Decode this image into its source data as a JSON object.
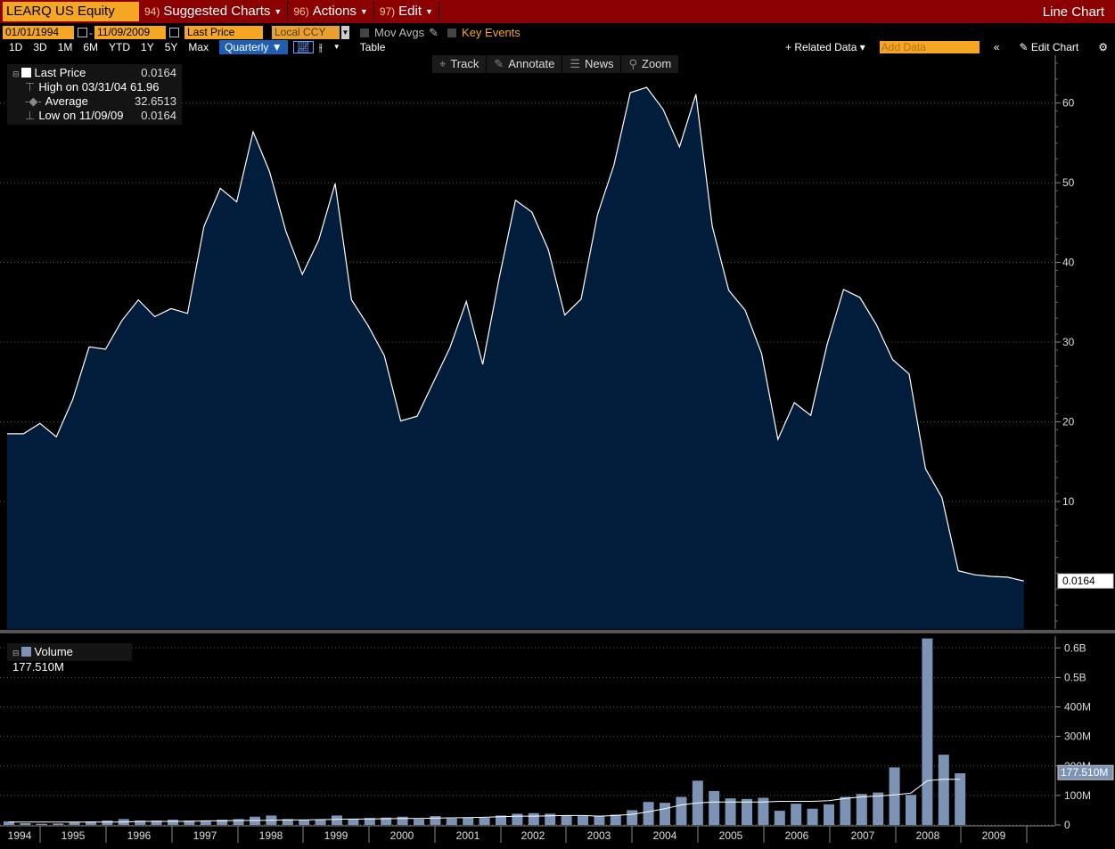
{
  "toolbar": {
    "ticker": "LEARQ US Equity",
    "suggested_num": "94)",
    "suggested_label": "Suggested Charts",
    "actions_num": "96)",
    "actions_label": "Actions",
    "edit_num": "97)",
    "edit_label": "Edit",
    "chart_type": "Line Chart"
  },
  "controls": {
    "start_date": "01/01/1994",
    "end_date": "11/09/2009",
    "field": "Last Price",
    "currency": "Local CCY",
    "mov_avgs": "Mov Avgs",
    "key_events": "Key Events",
    "periods": [
      "1D",
      "3D",
      "1M",
      "6M",
      "YTD",
      "1Y",
      "5Y",
      "Max"
    ],
    "frequency": "Quarterly",
    "table": "Table",
    "related_data": "+ Related Data",
    "add_data_placeholder": "Add Data",
    "edit_chart": "Edit Chart"
  },
  "tools": [
    "Track",
    "Annotate",
    "News",
    "Zoom"
  ],
  "legend": {
    "last_price_label": "Last Price",
    "last_price_value": "0.0164",
    "high_label": "High on 03/31/04",
    "high_value": "61.96",
    "average_label": "Average",
    "average_value": "32.6513",
    "low_label": "Low on 11/09/09",
    "low_value": "0.0164",
    "volume_label": "Volume",
    "volume_value": "177.510M"
  },
  "chart_data": [
    {
      "type": "area",
      "series": [
        {
          "name": "Last Price",
          "values": [
            18.5,
            18.5,
            19.8,
            18.1,
            22.8,
            29.4,
            29.1,
            32.7,
            35.3,
            33.2,
            34.2,
            33.6,
            44.5,
            49.3,
            47.6,
            56.4,
            51.4,
            43.9,
            38.5,
            42.8,
            49.9,
            35.3,
            32.1,
            28.3,
            20.1,
            20.7,
            25.0,
            29.3,
            35.1,
            27.2,
            38.0,
            47.8,
            46.3,
            41.6,
            33.4,
            35.4,
            46.0,
            52.2,
            61.3,
            61.96,
            59.2,
            54.5,
            61.1,
            44.5,
            36.5,
            34.0,
            28.6,
            17.8,
            22.4,
            20.8,
            29.7,
            36.6,
            35.6,
            32.2,
            27.8,
            26.0,
            14.1,
            10.5,
            1.3,
            0.8,
            0.6,
            0.5,
            0.0164
          ]
        }
      ],
      "x_start": "1994-Q1",
      "x_ticks": [
        "1994",
        "1995",
        "1996",
        "1997",
        "1998",
        "1999",
        "2000",
        "2001",
        "2002",
        "2003",
        "2004",
        "2005",
        "2006",
        "2007",
        "2008",
        "2009"
      ],
      "y_ticks": [
        10,
        20,
        30,
        40,
        50,
        60
      ],
      "ylim": [
        -6,
        66
      ],
      "last_label": "0.0164",
      "grid": true
    },
    {
      "type": "bar",
      "series": [
        {
          "name": "Volume",
          "values": [
            12,
            6,
            4,
            5,
            10,
            12,
            15,
            20,
            15,
            15,
            18,
            15,
            14,
            18,
            20,
            28,
            32,
            20,
            18,
            18,
            32,
            20,
            24,
            25,
            28,
            20,
            30,
            22,
            24,
            24,
            32,
            38,
            40,
            38,
            32,
            30,
            30,
            35,
            50,
            78,
            75,
            95,
            150,
            115,
            90,
            88,
            92,
            48,
            72,
            55,
            70,
            95,
            105,
            110,
            195,
            102,
            632,
            238,
            175
          ]
        },
        {
          "name": "",
          "values": [
            10,
            10,
            10,
            10,
            10,
            10,
            10,
            10,
            12,
            12,
            12,
            12,
            14,
            14,
            15,
            15,
            16,
            17,
            17,
            18,
            19,
            20,
            20,
            21,
            22,
            22,
            23,
            24,
            25,
            26,
            28,
            30,
            30,
            31,
            32,
            32,
            30,
            32,
            36,
            45,
            55,
            68,
            75,
            78,
            78,
            78,
            78,
            80,
            80,
            80,
            82,
            90,
            95,
            98,
            102,
            108,
            150,
            155,
            155
          ]
        }
      ],
      "y_ticks": [
        "0",
        "100M",
        "200M",
        "300M",
        "400M",
        "0.5B",
        "0.6B"
      ],
      "y_tick_values": [
        0,
        100,
        200,
        300,
        400,
        500,
        600
      ],
      "ylim": [
        0,
        640
      ],
      "last_label": "177.510M",
      "last_value": 177.51,
      "grid": true
    }
  ],
  "colors": {
    "area_fill": "#021d3c",
    "line": "#ffffff",
    "volume_bar": "#7d93b5",
    "accent": "#f5a623",
    "topbar": "#8b0000"
  }
}
